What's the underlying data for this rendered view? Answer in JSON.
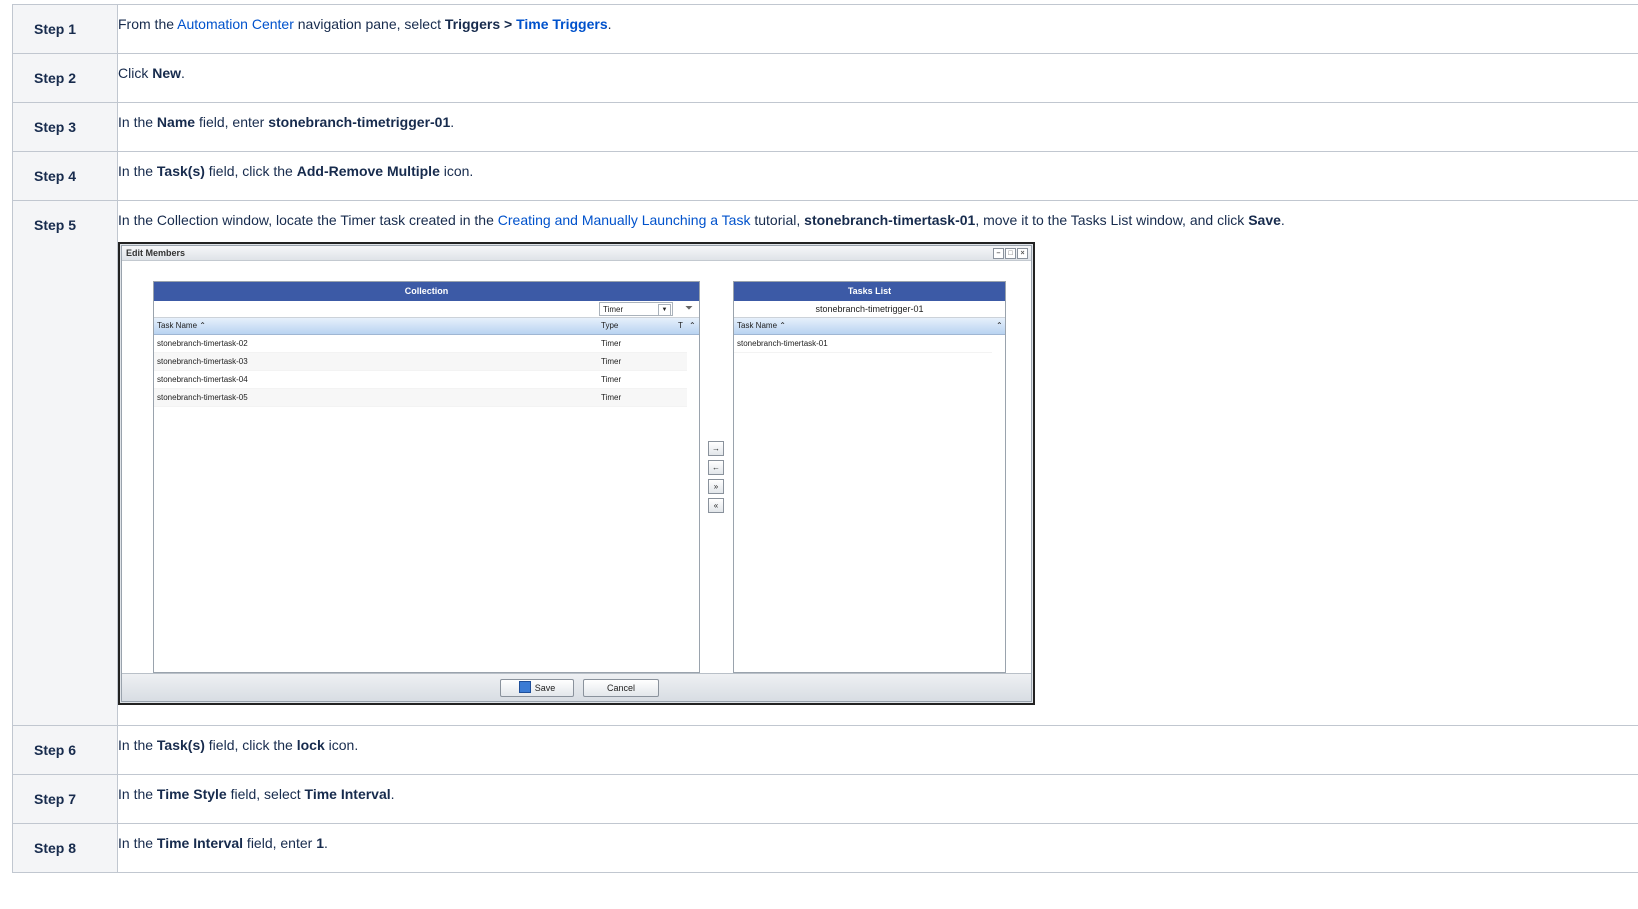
{
  "steps": [
    {
      "label": "Step 1",
      "parts": [
        {
          "t": "From the "
        },
        {
          "t": "Automation Center",
          "link": true
        },
        {
          "t": " navigation pane, select "
        },
        {
          "t": "Triggers > ",
          "bold": true
        },
        {
          "t": "Time Triggers",
          "bold": true,
          "link": true
        },
        {
          "t": "."
        }
      ]
    },
    {
      "label": "Step 2",
      "parts": [
        {
          "t": "Click "
        },
        {
          "t": "New",
          "bold": true
        },
        {
          "t": "."
        }
      ]
    },
    {
      "label": "Step 3",
      "parts": [
        {
          "t": "In the "
        },
        {
          "t": "Name",
          "bold": true
        },
        {
          "t": " field, enter "
        },
        {
          "t": "stonebranch-timetrigger-01",
          "bold": true
        },
        {
          "t": "."
        }
      ]
    },
    {
      "label": "Step 4",
      "parts": [
        {
          "t": "In the "
        },
        {
          "t": "Task(s)",
          "bold": true
        },
        {
          "t": " field, click the "
        },
        {
          "t": "Add-Remove Multiple",
          "bold": true
        },
        {
          "t": " icon."
        }
      ]
    },
    {
      "label": "Step 5",
      "parts": [
        {
          "t": "In the Collection window, locate the Timer task created in the "
        },
        {
          "t": "Creating and Manually Launching a Task",
          "link": true
        },
        {
          "t": " tutorial, "
        },
        {
          "t": "stonebranch-timertask-01",
          "bold": true
        },
        {
          "t": ", move it to the Tasks List window, and click "
        },
        {
          "t": "Save",
          "bold": true
        },
        {
          "t": "."
        }
      ]
    },
    {
      "label": "Step 6",
      "parts": [
        {
          "t": "In the "
        },
        {
          "t": "Task(s)",
          "bold": true
        },
        {
          "t": " field, click the "
        },
        {
          "t": "lock",
          "bold": true
        },
        {
          "t": " icon."
        }
      ]
    },
    {
      "label": "Step 7",
      "parts": [
        {
          "t": "In the "
        },
        {
          "t": "Time Style",
          "bold": true
        },
        {
          "t": " field, select "
        },
        {
          "t": "Time Interval",
          "bold": true
        },
        {
          "t": "."
        }
      ]
    },
    {
      "label": "Step 8",
      "parts": [
        {
          "t": "In the "
        },
        {
          "t": "Time Interval",
          "bold": true
        },
        {
          "t": " field, enter "
        },
        {
          "t": "1",
          "bold": true
        },
        {
          "t": "."
        }
      ]
    }
  ],
  "dialog": {
    "title": "Edit Members",
    "collection": {
      "header": "Collection",
      "filter_value": "Timer",
      "col_name": "Task Name",
      "col_type": "Type",
      "col_extra": "T",
      "rows": [
        {
          "name": "stonebranch-timertask-02",
          "type": "Timer"
        },
        {
          "name": "stonebranch-timertask-03",
          "type": "Timer"
        },
        {
          "name": "stonebranch-timertask-04",
          "type": "Timer"
        },
        {
          "name": "stonebranch-timertask-05",
          "type": "Timer"
        }
      ]
    },
    "tasks_list": {
      "header": "Tasks List",
      "subtitle": "stonebranch-timetrigger-01",
      "col_name": "Task Name",
      "rows": [
        {
          "name": "stonebranch-timertask-01"
        }
      ]
    },
    "move_buttons": [
      "→",
      "←",
      "»",
      "«"
    ],
    "save_label": "Save",
    "cancel_label": "Cancel"
  },
  "colors": {
    "link": "#0052cc",
    "pane_header": "#3c5aa6",
    "step_cell": "#f4f5f7"
  }
}
